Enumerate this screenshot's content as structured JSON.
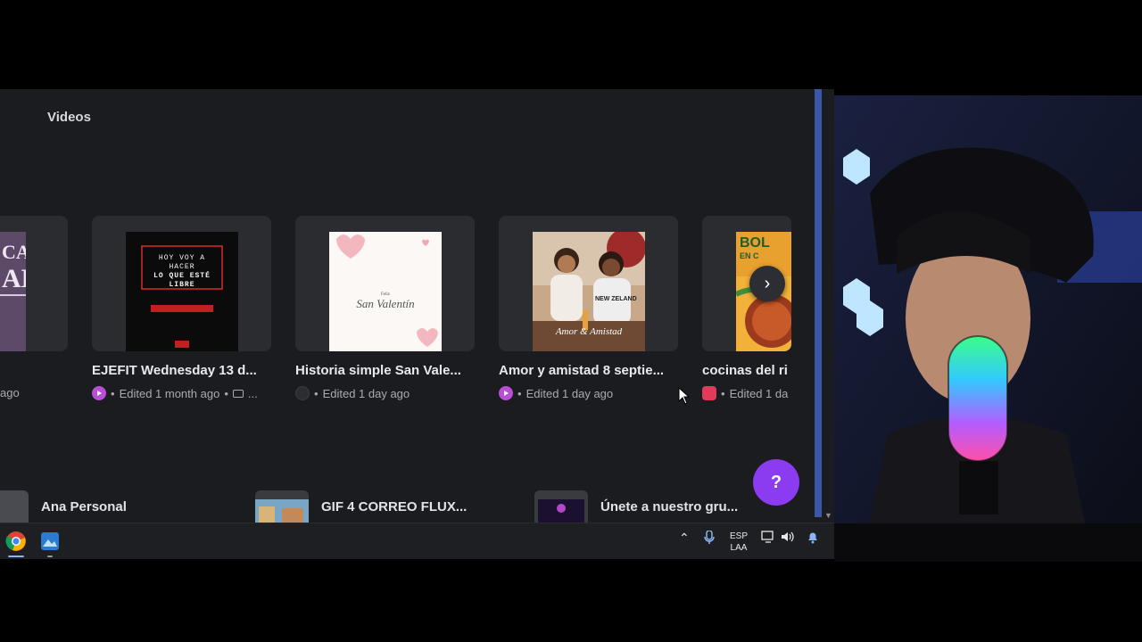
{
  "tabs": {
    "videos": "Videos"
  },
  "designs": [
    {
      "title": "",
      "meta": "ago",
      "badge": "none"
    },
    {
      "title": "EJEFIT Wednesday 13 d...",
      "meta": "Edited 1 month ago",
      "badge": "video",
      "folder_hint": "..."
    },
    {
      "title": "Historia simple San Vale...",
      "meta": "Edited 1 day ago",
      "badge": "docs"
    },
    {
      "title": "Amor y amistad 8 septie...",
      "meta": "Edited 1 day ago",
      "badge": "video"
    },
    {
      "title": "cocinas del ri",
      "meta": "Edited 1 da",
      "badge": "insta"
    }
  ],
  "thumb_text": {
    "ejefit_line1": "HOY VOY A",
    "ejefit_line2": "HACER",
    "ejefit_line3": "LO QUE ESTÉ",
    "ejefit_line4": "LIBRE",
    "valentin_small": "Feliz",
    "valentin_script": "San Valentín",
    "amor_script": "Amor & Amistad",
    "amor_shirt": "NEW ZELAND",
    "cocinas_word": "BOL",
    "cocinas_sub": "EN C"
  },
  "folders": [
    {
      "name": "Ana Personal"
    },
    {
      "name": "GIF 4 CORREO FLUX..."
    },
    {
      "name": "Únete a nuestro gru..."
    }
  ],
  "help_label": "?",
  "taskbar": {
    "lang_top": "ESP",
    "lang_bottom": "LAA"
  },
  "colors": {
    "background": "#1b1c1f",
    "card": "#2b2c30",
    "accent_purple": "#8b3cf0",
    "video_badge": "#b84fd6"
  }
}
